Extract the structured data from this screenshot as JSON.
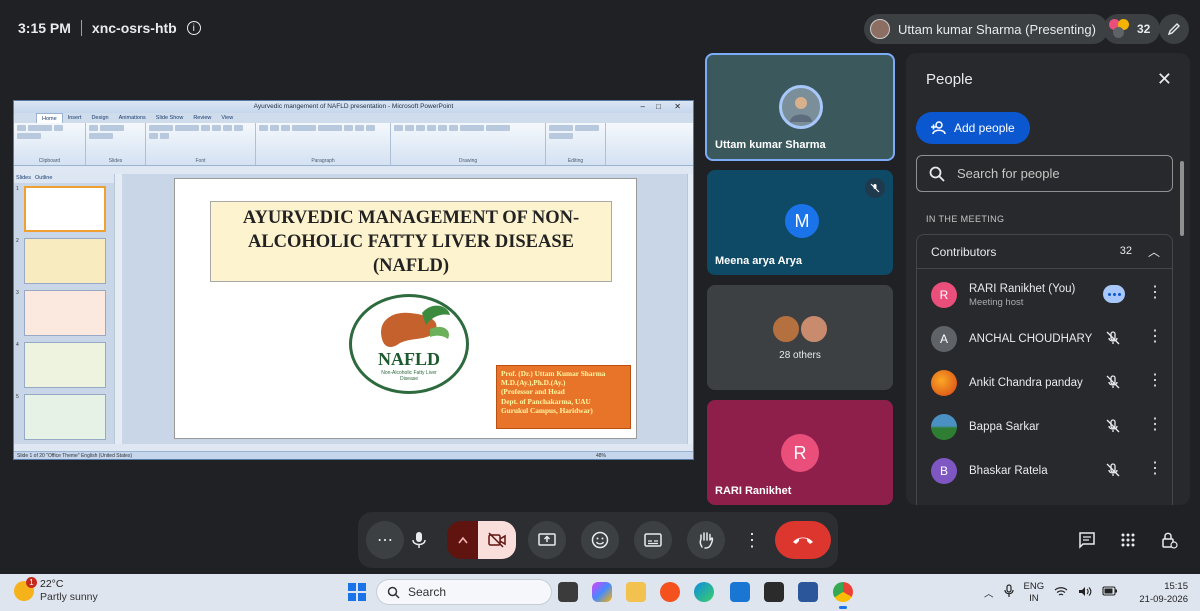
{
  "topbar": {
    "time": "3:15 PM",
    "meeting_code": "xnc-osrs-htb",
    "presenter_chip": "Uttam kumar Sharma (Presenting)",
    "participant_count": "32"
  },
  "presentation": {
    "window_title": "Ayurvedic mangement of NAFLD presentation - Microsoft PowerPoint",
    "ribbon_tabs": [
      "Home",
      "Insert",
      "Design",
      "Animations",
      "Slide Show",
      "Review",
      "View"
    ],
    "ribbon_groups": [
      "Clipboard",
      "Slides",
      "Font",
      "Paragraph",
      "Drawing",
      "Editing"
    ],
    "pane_tabs": [
      "Slides",
      "Outline"
    ],
    "slide_numbers": [
      "1",
      "2",
      "3",
      "4",
      "5"
    ],
    "slide_title": "AYURVEDIC MANAGEMENT OF NON-ALCOHOLIC FATTY LIVER DISEASE (NAFLD)",
    "logo_text": "NAFLD",
    "logo_subtext": "Non-Alcoholic Fatty Liver Disease",
    "author_lines": [
      "Prof. (Dr.) Uttam Kumar Sharma",
      "M.D.(Ay.),Ph.D.(Ay.)",
      "(Professor and Head",
      "Dept. of  Panchakarma, UAU",
      "Gurukul Campus, Haridwar)"
    ],
    "status": "Slide 1 of 20    \"Office Theme\"    English (United States)",
    "zoom": "48%"
  },
  "tiles": [
    {
      "name": "Uttam kumar Sharma"
    },
    {
      "name": "Meena arya Arya",
      "initial": "M",
      "color": "#1a73e8"
    },
    {
      "name": "28 others"
    },
    {
      "name": "RARI Ranikhet",
      "initial": "R",
      "color": "#e94f7a"
    }
  ],
  "panel": {
    "title": "People",
    "add_people": "Add people",
    "search_placeholder": "Search for people",
    "section_label": "IN THE MEETING",
    "group_label": "Contributors",
    "group_count": "32",
    "people": [
      {
        "name": "RARI Ranikhet (You)",
        "sub": "Meeting host",
        "initial": "R",
        "color": "#e94f7a"
      },
      {
        "name": "ANCHAL CHOUDHARY",
        "initial": "A",
        "color": "#5f6368"
      },
      {
        "name": "Ankit Chandra panday",
        "initial": "",
        "color": "#e8501f"
      },
      {
        "name": "Bappa Sarkar",
        "initial": "",
        "color": "#2e8b57"
      },
      {
        "name": "Bhaskar Ratela",
        "initial": "B",
        "color": "#7e57c2"
      }
    ]
  },
  "taskbar": {
    "temperature": "22°C",
    "weather": "Partly sunny",
    "weather_badge": "1",
    "search_label": "Search",
    "lang_1": "ENG",
    "lang_2": "IN",
    "clock_time": "15:15",
    "clock_date": "21-09-2026"
  }
}
